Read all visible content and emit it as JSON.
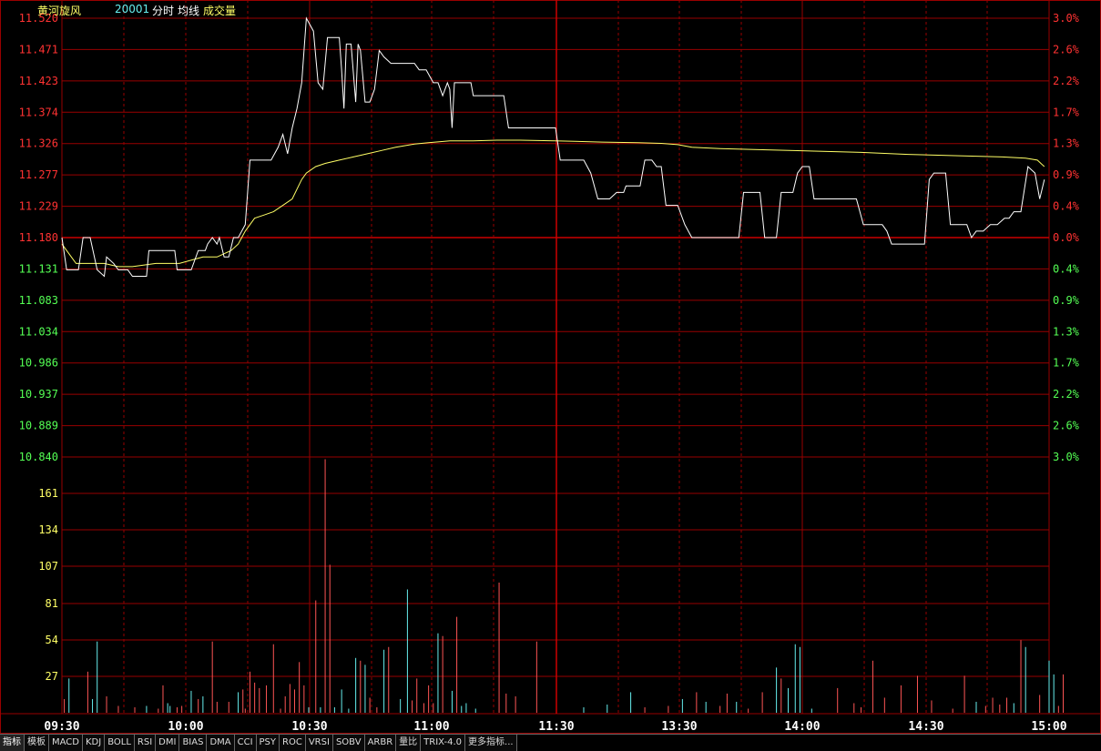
{
  "header": {
    "stock_name": "黄河旋风",
    "stock_code": "20001",
    "label_fenshi": "分时",
    "label_junxian": "均线",
    "label_volume": "成交量"
  },
  "colors": {
    "background": "#000000",
    "grid": "#990000",
    "up": "#ff3232",
    "down": "#54ff54",
    "price_line": "#ffffff",
    "avg_line": "#ffff66",
    "vol_up": "#ff5555",
    "vol_down": "#66eeee",
    "vol_axis": "#ffff66"
  },
  "chart_data": {
    "type": "line",
    "time_ticks": [
      "09:30",
      "10:00",
      "10:30",
      "11:00",
      "11:30",
      "13:30",
      "14:00",
      "14:30",
      "15:00"
    ],
    "price_ticks": [
      "11.520",
      "11.471",
      "11.423",
      "11.374",
      "11.326",
      "11.277",
      "11.229",
      "11.180",
      "11.131",
      "11.083",
      "11.034",
      "10.986",
      "10.937",
      "10.889",
      "10.840"
    ],
    "pct_ticks": [
      "3.0%",
      "2.6%",
      "2.2%",
      "1.7%",
      "1.3%",
      "0.9%",
      "0.4%",
      "0.0%",
      "0.4%",
      "0.9%",
      "1.3%",
      "1.7%",
      "2.2%",
      "2.6%",
      "3.0%"
    ],
    "ref_price": 11.18,
    "price_ylim": [
      10.84,
      11.52
    ],
    "volume_ticks": [
      "161",
      "134",
      "107",
      "81",
      "54",
      "27"
    ],
    "volume_ylim": [
      0,
      188
    ],
    "price_series": [
      [
        0,
        11.18
      ],
      [
        2,
        11.13
      ],
      [
        7,
        11.13
      ],
      [
        9,
        11.18
      ],
      [
        12,
        11.18
      ],
      [
        15,
        11.13
      ],
      [
        18,
        11.12
      ],
      [
        19,
        11.15
      ],
      [
        22,
        11.14
      ],
      [
        24,
        11.13
      ],
      [
        28,
        11.13
      ],
      [
        30,
        11.12
      ],
      [
        36,
        11.12
      ],
      [
        37,
        11.16
      ],
      [
        48,
        11.16
      ],
      [
        49,
        11.13
      ],
      [
        55,
        11.13
      ],
      [
        58,
        11.16
      ],
      [
        61,
        11.16
      ],
      [
        62,
        11.17
      ],
      [
        64,
        11.18
      ],
      [
        66,
        11.17
      ],
      [
        67,
        11.18
      ],
      [
        69,
        11.15
      ],
      [
        71,
        11.15
      ],
      [
        73,
        11.18
      ],
      [
        75,
        11.18
      ],
      [
        78,
        11.2
      ],
      [
        80,
        11.3
      ],
      [
        89,
        11.3
      ],
      [
        92,
        11.32
      ],
      [
        94,
        11.34
      ],
      [
        96,
        11.31
      ],
      [
        98,
        11.35
      ],
      [
        100,
        11.38
      ],
      [
        102,
        11.42
      ],
      [
        104,
        11.52
      ],
      [
        107,
        11.5
      ],
      [
        109,
        11.42
      ],
      [
        111,
        11.41
      ],
      [
        113,
        11.49
      ],
      [
        118,
        11.49
      ],
      [
        119,
        11.44
      ],
      [
        120,
        11.38
      ],
      [
        121,
        11.48
      ],
      [
        123,
        11.48
      ],
      [
        125,
        11.39
      ],
      [
        126,
        11.48
      ],
      [
        127,
        11.47
      ],
      [
        129,
        11.39
      ],
      [
        131,
        11.39
      ],
      [
        133,
        11.41
      ],
      [
        135,
        11.47
      ],
      [
        137,
        11.46
      ],
      [
        140,
        11.45
      ],
      [
        150,
        11.45
      ],
      [
        152,
        11.44
      ],
      [
        155,
        11.44
      ],
      [
        158,
        11.42
      ],
      [
        160,
        11.42
      ],
      [
        162,
        11.4
      ],
      [
        164,
        11.42
      ],
      [
        165,
        11.41
      ],
      [
        166,
        11.35
      ],
      [
        167,
        11.42
      ],
      [
        174,
        11.42
      ],
      [
        175,
        11.4
      ],
      [
        188,
        11.4
      ],
      [
        190,
        11.35
      ],
      [
        210,
        11.35
      ],
      [
        212,
        11.3
      ],
      [
        222,
        11.3
      ],
      [
        225,
        11.28
      ],
      [
        228,
        11.24
      ],
      [
        233,
        11.24
      ],
      [
        236,
        11.25
      ],
      [
        239,
        11.25
      ],
      [
        240,
        11.26
      ],
      [
        246,
        11.26
      ],
      [
        248,
        11.3
      ],
      [
        251,
        11.3
      ],
      [
        253,
        11.29
      ],
      [
        255,
        11.29
      ],
      [
        257,
        11.23
      ],
      [
        262,
        11.23
      ],
      [
        265,
        11.2
      ],
      [
        268,
        11.18
      ],
      [
        288,
        11.18
      ],
      [
        290,
        11.25
      ],
      [
        297,
        11.25
      ],
      [
        299,
        11.18
      ],
      [
        304,
        11.18
      ],
      [
        306,
        11.25
      ],
      [
        311,
        11.25
      ],
      [
        313,
        11.28
      ],
      [
        315,
        11.29
      ],
      [
        318,
        11.29
      ],
      [
        320,
        11.24
      ],
      [
        325,
        11.24
      ],
      [
        338,
        11.24
      ],
      [
        341,
        11.2
      ],
      [
        349,
        11.2
      ],
      [
        351,
        11.19
      ],
      [
        353,
        11.17
      ],
      [
        367,
        11.17
      ],
      [
        369,
        11.27
      ],
      [
        371,
        11.28
      ],
      [
        376,
        11.28
      ],
      [
        378,
        11.2
      ],
      [
        385,
        11.2
      ],
      [
        387,
        11.18
      ],
      [
        389,
        11.19
      ],
      [
        392,
        11.19
      ],
      [
        395,
        11.2
      ],
      [
        398,
        11.2
      ],
      [
        401,
        11.21
      ],
      [
        403,
        11.21
      ],
      [
        405,
        11.22
      ],
      [
        408,
        11.22
      ],
      [
        411,
        11.29
      ],
      [
        414,
        11.28
      ],
      [
        416,
        11.24
      ],
      [
        418,
        11.27
      ]
    ],
    "avg_series": [
      [
        0,
        11.17
      ],
      [
        6,
        11.14
      ],
      [
        12,
        11.14
      ],
      [
        18,
        11.14
      ],
      [
        24,
        11.135
      ],
      [
        30,
        11.135
      ],
      [
        40,
        11.14
      ],
      [
        50,
        11.14
      ],
      [
        60,
        11.15
      ],
      [
        66,
        11.15
      ],
      [
        72,
        11.16
      ],
      [
        75,
        11.17
      ],
      [
        78,
        11.19
      ],
      [
        82,
        11.21
      ],
      [
        86,
        11.215
      ],
      [
        90,
        11.22
      ],
      [
        94,
        11.23
      ],
      [
        98,
        11.24
      ],
      [
        100,
        11.255
      ],
      [
        102,
        11.27
      ],
      [
        104,
        11.28
      ],
      [
        108,
        11.29
      ],
      [
        112,
        11.295
      ],
      [
        118,
        11.3
      ],
      [
        124,
        11.305
      ],
      [
        130,
        11.31
      ],
      [
        136,
        11.315
      ],
      [
        142,
        11.32
      ],
      [
        150,
        11.325
      ],
      [
        156,
        11.327
      ],
      [
        165,
        11.33
      ],
      [
        175,
        11.33
      ],
      [
        185,
        11.331
      ],
      [
        195,
        11.331
      ],
      [
        210,
        11.33
      ],
      [
        230,
        11.328
      ],
      [
        245,
        11.327
      ],
      [
        255,
        11.326
      ],
      [
        262,
        11.324
      ],
      [
        268,
        11.32
      ],
      [
        280,
        11.318
      ],
      [
        300,
        11.316
      ],
      [
        320,
        11.314
      ],
      [
        340,
        11.312
      ],
      [
        360,
        11.309
      ],
      [
        380,
        11.307
      ],
      [
        400,
        11.305
      ],
      [
        410,
        11.303
      ],
      [
        415,
        11.3
      ],
      [
        418,
        11.29
      ]
    ],
    "volume_series": [
      [
        1,
        10,
        0
      ],
      [
        3,
        25,
        1
      ],
      [
        11,
        30,
        0
      ],
      [
        13,
        10,
        1
      ],
      [
        15,
        52,
        1
      ],
      [
        19,
        12,
        0
      ],
      [
        24,
        5,
        0
      ],
      [
        31,
        4,
        0
      ],
      [
        36,
        5,
        1
      ],
      [
        41,
        3,
        0
      ],
      [
        43,
        20,
        0
      ],
      [
        45,
        7,
        1
      ],
      [
        46,
        5,
        1
      ],
      [
        49,
        4,
        0
      ],
      [
        51,
        5,
        0
      ],
      [
        55,
        16,
        1
      ],
      [
        58,
        10,
        0
      ],
      [
        60,
        12,
        1
      ],
      [
        64,
        52,
        0
      ],
      [
        66,
        8,
        0
      ],
      [
        71,
        8,
        0
      ],
      [
        75,
        15,
        1
      ],
      [
        77,
        17,
        0
      ],
      [
        78,
        3,
        0
      ],
      [
        80,
        30,
        0
      ],
      [
        82,
        22,
        0
      ],
      [
        84,
        18,
        0
      ],
      [
        87,
        20,
        0
      ],
      [
        90,
        50,
        0
      ],
      [
        93,
        3,
        0
      ],
      [
        95,
        12,
        0
      ],
      [
        97,
        21,
        0
      ],
      [
        99,
        17,
        0
      ],
      [
        101,
        37,
        0
      ],
      [
        103,
        20,
        0
      ],
      [
        105,
        4,
        1
      ],
      [
        108,
        82,
        0
      ],
      [
        110,
        4,
        1
      ],
      [
        112,
        185,
        0
      ],
      [
        114,
        108,
        0
      ],
      [
        116,
        4,
        1
      ],
      [
        119,
        17,
        1
      ],
      [
        122,
        3,
        1
      ],
      [
        125,
        40,
        1
      ],
      [
        127,
        38,
        0
      ],
      [
        129,
        35,
        1
      ],
      [
        131,
        11,
        0
      ],
      [
        134,
        4,
        0
      ],
      [
        137,
        46,
        1
      ],
      [
        139,
        48,
        0
      ],
      [
        144,
        10,
        1
      ],
      [
        147,
        90,
        1
      ],
      [
        149,
        9,
        0
      ],
      [
        151,
        25,
        0
      ],
      [
        154,
        7,
        0
      ],
      [
        156,
        20,
        0
      ],
      [
        158,
        7,
        0
      ],
      [
        160,
        58,
        1
      ],
      [
        162,
        56,
        0
      ],
      [
        166,
        16,
        1
      ],
      [
        168,
        70,
        0
      ],
      [
        170,
        5,
        1
      ],
      [
        172,
        7,
        1
      ],
      [
        176,
        3,
        1
      ],
      [
        186,
        95,
        0
      ],
      [
        189,
        14,
        0
      ],
      [
        193,
        12,
        0
      ],
      [
        202,
        52,
        0
      ],
      [
        222,
        4,
        1
      ],
      [
        232,
        6,
        1
      ],
      [
        242,
        15,
        1
      ],
      [
        248,
        4,
        0
      ],
      [
        258,
        5,
        0
      ],
      [
        264,
        10,
        1
      ],
      [
        270,
        15,
        0
      ],
      [
        274,
        8,
        1
      ],
      [
        280,
        5,
        0
      ],
      [
        283,
        14,
        0
      ],
      [
        287,
        8,
        1
      ],
      [
        292,
        3,
        0
      ],
      [
        298,
        15,
        0
      ],
      [
        304,
        33,
        1
      ],
      [
        306,
        25,
        0
      ],
      [
        309,
        18,
        1
      ],
      [
        312,
        50,
        1
      ],
      [
        314,
        48,
        1
      ],
      [
        319,
        3,
        1
      ],
      [
        330,
        18,
        0
      ],
      [
        337,
        7,
        0
      ],
      [
        340,
        4,
        0
      ],
      [
        345,
        38,
        0
      ],
      [
        350,
        11,
        0
      ],
      [
        357,
        20,
        0
      ],
      [
        364,
        27,
        0
      ],
      [
        370,
        9,
        0
      ],
      [
        379,
        3,
        0
      ],
      [
        384,
        27,
        0
      ],
      [
        389,
        8,
        1
      ],
      [
        393,
        5,
        0
      ],
      [
        396,
        11,
        0
      ],
      [
        399,
        6,
        0
      ],
      [
        402,
        11,
        0
      ],
      [
        405,
        7,
        1
      ],
      [
        410,
        48,
        1
      ],
      [
        416,
        13,
        0
      ],
      [
        420,
        38,
        1
      ],
      [
        422,
        28,
        1
      ],
      [
        424,
        5,
        0
      ],
      [
        426,
        28,
        0
      ],
      [
        408,
        53,
        0
      ]
    ]
  },
  "toolbar": {
    "items": [
      "指标",
      "模板",
      "MACD",
      "KDJ",
      "BOLL",
      "RSI",
      "DMI",
      "BIAS",
      "DMA",
      "CCI",
      "PSY",
      "ROC",
      "VRSI",
      "SOBV",
      "ARBR",
      "量比",
      "TRIX-4.0",
      "更多指标..."
    ]
  }
}
